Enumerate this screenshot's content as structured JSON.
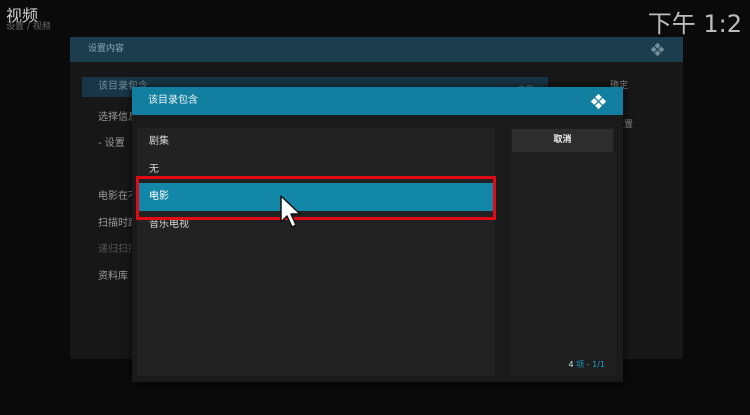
{
  "header": {
    "title": "视频",
    "subtitle": "设置 / 视频",
    "clock": "下午 1:2"
  },
  "background_dialog": {
    "title": "设置内容",
    "rows": [
      "该目录包含",
      "选择信息提供者",
      "- 设置",
      "电影在不同的目录中",
      "扫描时跳过",
      "递归扫描",
      "资料库"
    ],
    "right_values": [
      "电影",
      "确定",
      "设置"
    ]
  },
  "dialog": {
    "title": "该目录包含",
    "items": [
      {
        "label": "剧集",
        "selected": false
      },
      {
        "label": "无",
        "selected": false
      },
      {
        "label": "电影",
        "selected": true
      },
      {
        "label": "音乐电视",
        "selected": false
      }
    ],
    "cancel_label": "取消",
    "counter_num": "4",
    "counter_text": "项 - 1/1"
  },
  "colors": {
    "accent": "#137fa0",
    "selection": "#1387a8",
    "highlight_box": "#e00b16"
  }
}
